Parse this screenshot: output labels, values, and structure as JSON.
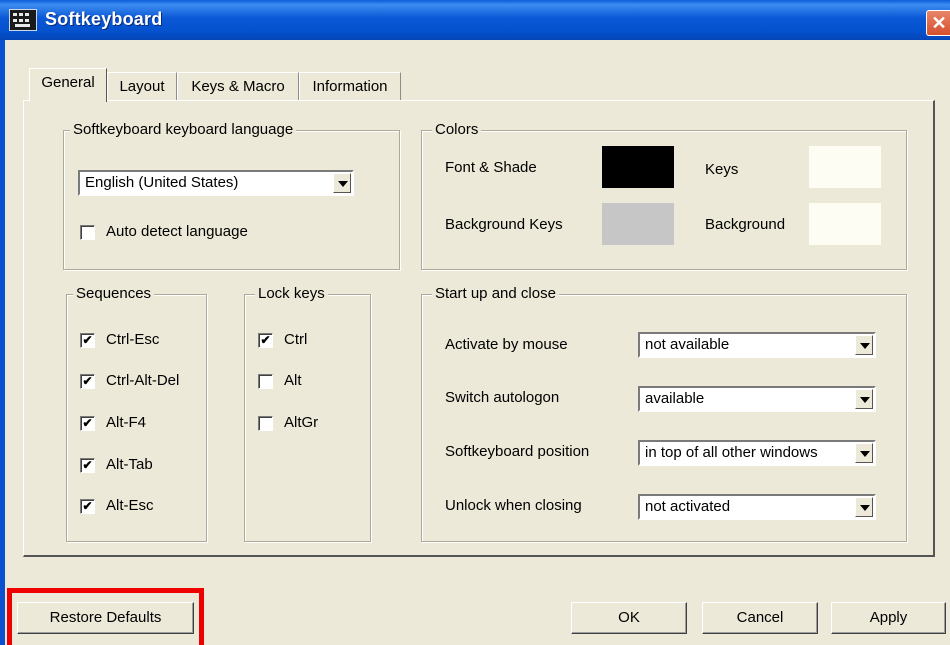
{
  "window": {
    "title": "Softkeyboard",
    "close_glyph": "✕"
  },
  "tabs": [
    "General",
    "Layout",
    "Keys & Macro",
    "Information"
  ],
  "language_group": {
    "legend": "Softkeyboard keyboard language",
    "selected": "English (United States)",
    "auto_detect": {
      "label": "Auto detect language",
      "checked": false
    }
  },
  "colors_group": {
    "legend": "Colors",
    "items": [
      {
        "label": "Font & Shade",
        "color": "#000000"
      },
      {
        "label": "Keys",
        "color": "#fdfdf3"
      },
      {
        "label": "Background Keys",
        "color": "#c6c6c6"
      },
      {
        "label": "Background",
        "color": "#fdfdf3"
      }
    ]
  },
  "sequences_group": {
    "legend": "Sequences",
    "items": [
      {
        "label": "Ctrl-Esc",
        "checked": true
      },
      {
        "label": "Ctrl-Alt-Del",
        "checked": true
      },
      {
        "label": "Alt-F4",
        "checked": true
      },
      {
        "label": "Alt-Tab",
        "checked": true
      },
      {
        "label": "Alt-Esc",
        "checked": true
      }
    ]
  },
  "lockkeys_group": {
    "legend": "Lock keys",
    "items": [
      {
        "label": "Ctrl",
        "checked": true
      },
      {
        "label": "Alt",
        "checked": false
      },
      {
        "label": "AltGr",
        "checked": false
      }
    ]
  },
  "startup_group": {
    "legend": "Start up and close",
    "rows": [
      {
        "label": "Activate by mouse",
        "value": "not available"
      },
      {
        "label": "Switch autologon",
        "value": "available"
      },
      {
        "label": "Softkeyboard position",
        "value": "in top of all other windows"
      },
      {
        "label": "Unlock when closing",
        "value": "not activated"
      }
    ]
  },
  "buttons": {
    "restore_defaults": "Restore Defaults",
    "ok": "OK",
    "cancel": "Cancel",
    "apply": "Apply"
  },
  "check_glyph": "✔",
  "highlight_color": "#ee0000"
}
